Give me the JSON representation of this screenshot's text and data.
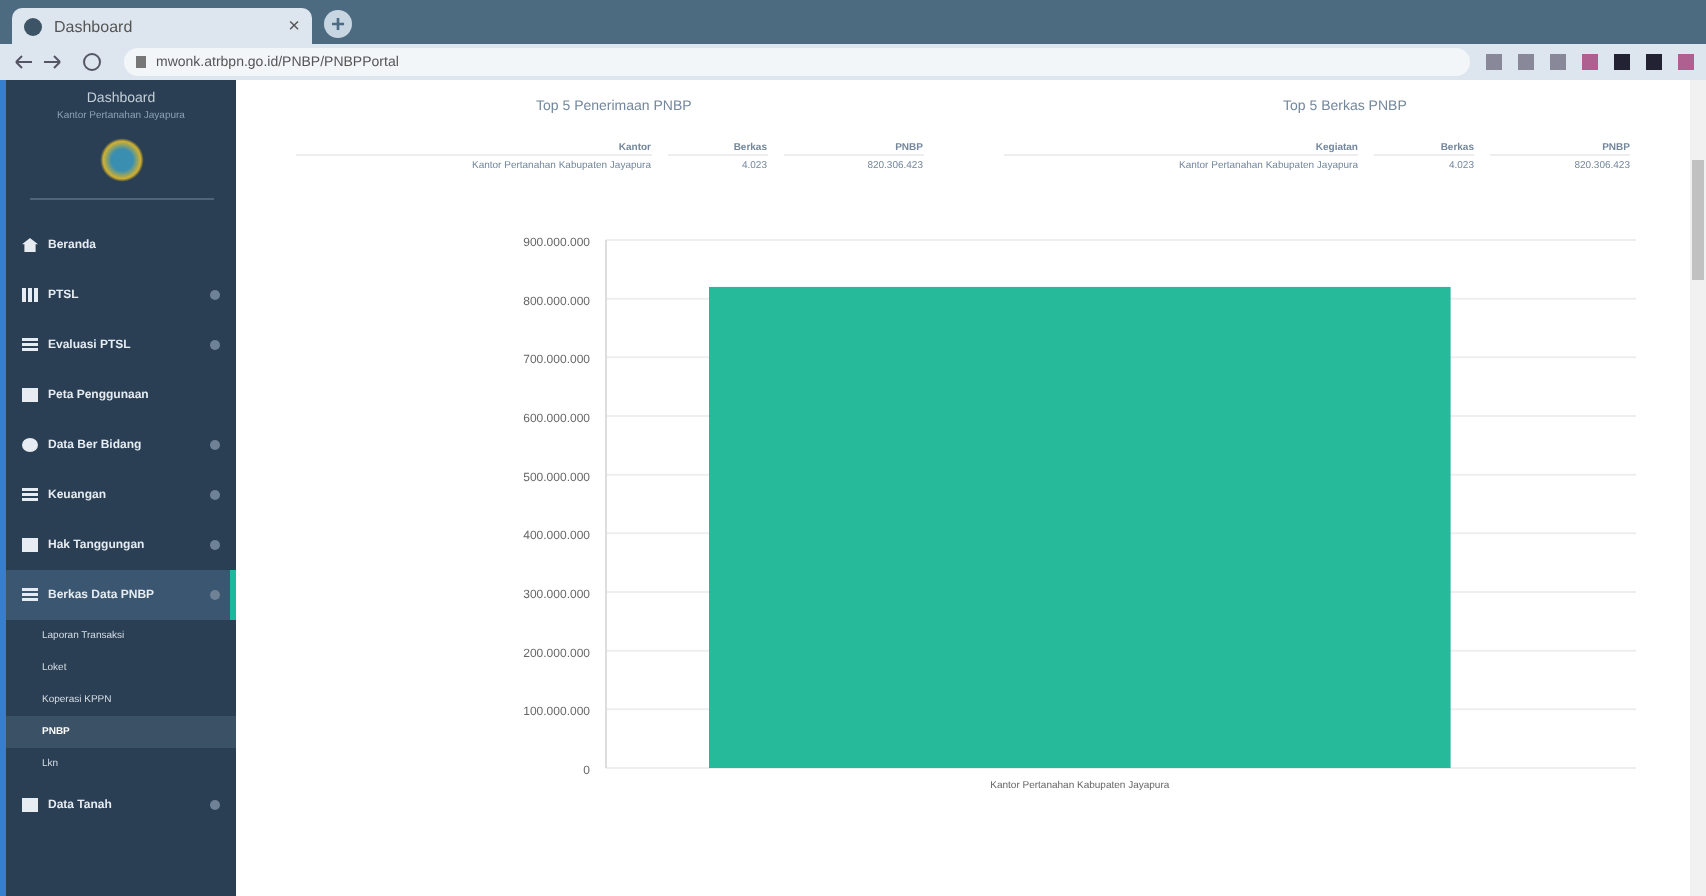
{
  "browser": {
    "tab_title": "Dashboard",
    "tab_close": "×",
    "new_tab": "+",
    "url": "mwonk.atrbpn.go.id/PNBP/PNBPPortal"
  },
  "sidebar": {
    "title": "Dashboard",
    "subtitle": "Kantor Pertanahan Jayapura",
    "items": [
      {
        "label": "Beranda",
        "has_caret": false,
        "selected": false
      },
      {
        "label": "PTSL",
        "has_caret": true,
        "selected": false
      },
      {
        "label": "Evaluasi PTSL",
        "has_caret": true,
        "selected": false
      },
      {
        "label": "Peta Penggunaan",
        "has_caret": false,
        "selected": false
      },
      {
        "label": "Data Ber Bidang",
        "has_caret": true,
        "selected": false
      },
      {
        "label": "Keuangan",
        "has_caret": true,
        "selected": false
      },
      {
        "label": "Hak Tanggungan",
        "has_caret": true,
        "selected": false
      },
      {
        "label": "Berkas Data PNBP",
        "has_caret": true,
        "selected": true,
        "children": [
          {
            "label": "Laporan Transaksi",
            "selected": false
          },
          {
            "label": "Loket",
            "selected": false
          },
          {
            "label": "Koperasi KPPN",
            "selected": false
          },
          {
            "label": "PNBP",
            "selected": true
          },
          {
            "label": "Lkn",
            "selected": false
          }
        ]
      },
      {
        "label": "Data Tanah",
        "has_caret": true,
        "selected": false
      }
    ]
  },
  "tables": [
    {
      "title": "Top 5 Penerimaan PNBP",
      "columns": [
        "Kantor",
        "Berkas",
        "PNBP"
      ],
      "rows": [
        [
          "Kantor Pertanahan Kabupaten Jayapura",
          "4.023",
          "820.306.423"
        ]
      ]
    },
    {
      "title": "Top 5 Berkas PNBP",
      "columns": [
        "Kegiatan",
        "Berkas",
        "PNBP"
      ],
      "rows": [
        [
          "Kantor Pertanahan Kabupaten Jayapura",
          "4.023",
          "820.306.423"
        ]
      ]
    }
  ],
  "chart_data": {
    "type": "bar",
    "categories": [
      "Kantor Pertanahan Kabupaten Jayapura"
    ],
    "values": [
      820000000
    ],
    "ylim": [
      0,
      900000000
    ],
    "grid": true,
    "yticks": [
      {
        "value": 0,
        "label": "0"
      },
      {
        "value": 100000000,
        "label": "100.000.000"
      },
      {
        "value": 200000000,
        "label": "200.000.000"
      },
      {
        "value": 300000000,
        "label": "300.000.000"
      },
      {
        "value": 400000000,
        "label": "400.000.000"
      },
      {
        "value": 500000000,
        "label": "500.000.000"
      },
      {
        "value": 600000000,
        "label": "600.000.000"
      },
      {
        "value": 700000000,
        "label": "700.000.000"
      },
      {
        "value": 800000000,
        "label": "800.000.000"
      },
      {
        "value": 900000000,
        "label": "900.000.000"
      }
    ]
  }
}
